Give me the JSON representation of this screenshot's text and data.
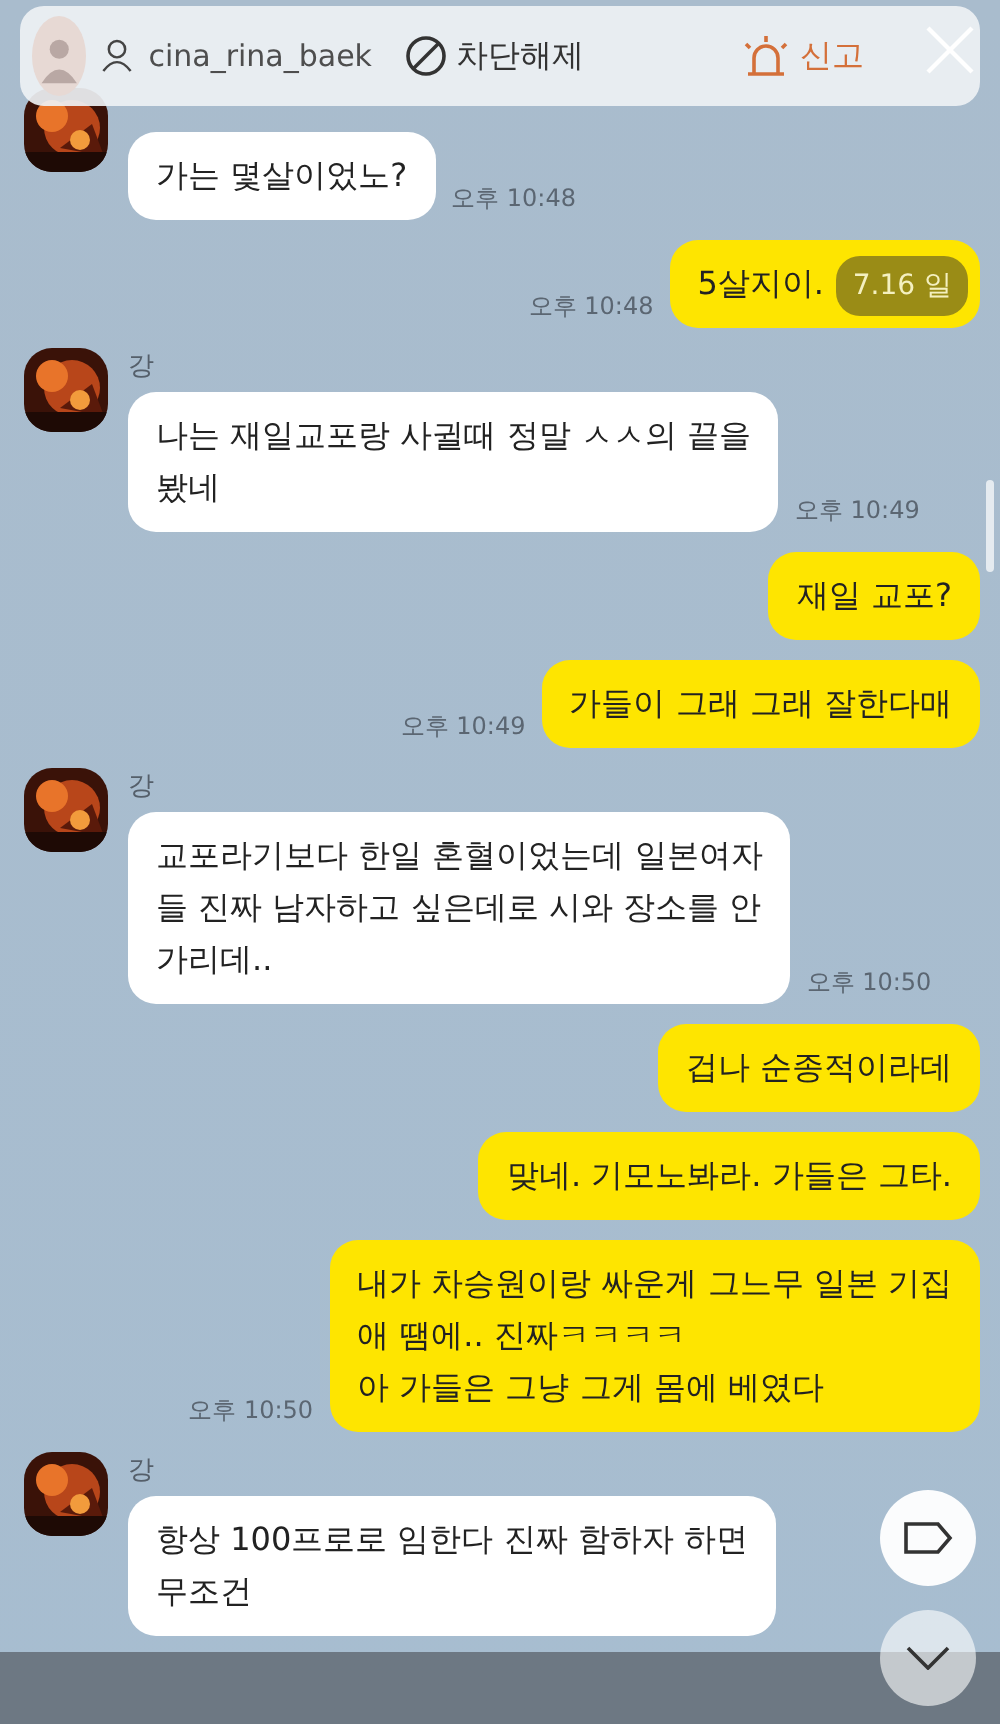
{
  "story_header": {
    "username": "cina_rina_baek",
    "actions": [
      {
        "kind": "block",
        "label": "차단해제"
      },
      {
        "kind": "report",
        "label": "신고"
      }
    ]
  },
  "date_badge": "7.16 일",
  "messages": [
    {
      "kind": "in",
      "lines": [
        "가는 몇살이었노?"
      ],
      "time": "오후 10:48"
    },
    {
      "kind": "out",
      "lines": [
        "5살지이."
      ],
      "time": "오후 10:48",
      "date": true
    },
    {
      "kind": "in",
      "name": "강",
      "lines": [
        "나는 재일교포랑 사귈때 정말 ㅅㅅ의 끝을",
        "봤네"
      ],
      "time": "오후 10:49"
    },
    {
      "kind": "out",
      "lines": [
        "재일 교포?"
      ]
    },
    {
      "kind": "out",
      "lines": [
        "가들이 그래 그래 잘한다매"
      ],
      "time": "오후 10:49"
    },
    {
      "kind": "in",
      "name": "강",
      "lines": [
        "교포라기보다 한일 혼혈이었는데 일본여자",
        "들 진짜 남자하고 싶은데로 시와 장소를 안",
        "가리데.."
      ],
      "time": "오후 10:50"
    },
    {
      "kind": "out",
      "lines": [
        "겁나 순종적이라데"
      ]
    },
    {
      "kind": "out",
      "lines": [
        "맞네. 기모노봐라. 가들은 그타."
      ]
    },
    {
      "kind": "out",
      "lines": [
        "내가 차승원이랑 싸운게 그느무 일본 기집",
        "애 땜에.. 진짜ㅋㅋㅋㅋ",
        "아 가들은 그냥 그게 몸에 베였다"
      ],
      "time": "오후 10:50"
    },
    {
      "kind": "in",
      "name": "강",
      "lines": [
        "항상 100프로로 임한다 진짜 함하자 하면",
        "무조건"
      ]
    }
  ]
}
